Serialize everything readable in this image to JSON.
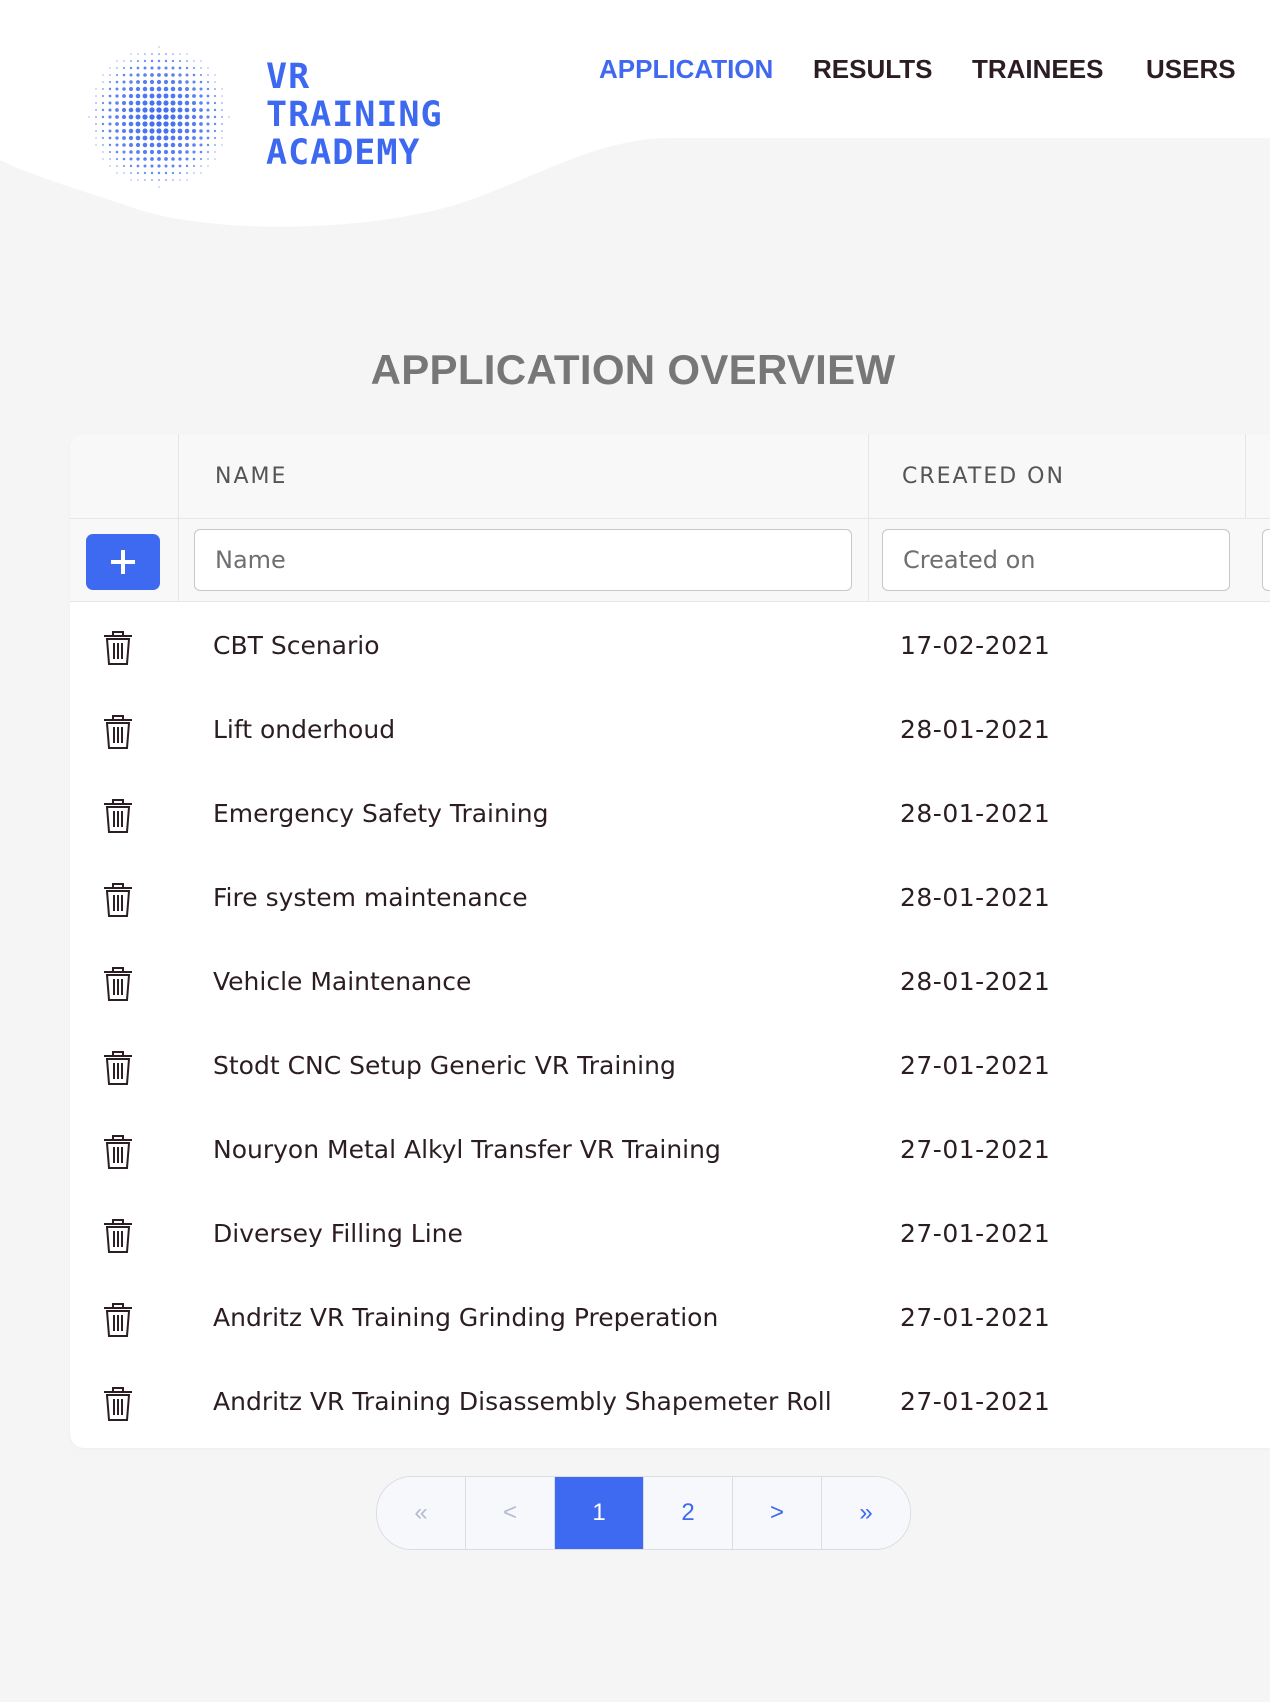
{
  "brand": {
    "line1": "VR",
    "line2": "TRAINING",
    "line3": "ACADEMY",
    "accent": "#3d6af0"
  },
  "nav": {
    "application": "APPLICATION",
    "results": "RESULTS",
    "trainees": "TRAINEES",
    "users": "USERS",
    "active": "APPLICATION"
  },
  "page": {
    "title": "APPLICATION OVERVIEW"
  },
  "table": {
    "columns": [
      "NAME",
      "CREATED ON"
    ],
    "filters": {
      "name_placeholder": "Name",
      "created_placeholder": "Created on"
    },
    "rows": [
      {
        "name": "CBT Scenario",
        "created": "17-02-2021"
      },
      {
        "name": "Lift onderhoud",
        "created": "28-01-2021"
      },
      {
        "name": "Emergency Safety Training",
        "created": "28-01-2021"
      },
      {
        "name": "Fire system maintenance",
        "created": "28-01-2021"
      },
      {
        "name": "Vehicle Maintenance",
        "created": "28-01-2021"
      },
      {
        "name": "Stodt CNC Setup Generic VR Training",
        "created": "27-01-2021"
      },
      {
        "name": "Nouryon Metal Alkyl Transfer VR Training",
        "created": "27-01-2021"
      },
      {
        "name": "Diversey Filling Line",
        "created": "27-01-2021"
      },
      {
        "name": "Andritz VR Training Grinding Preperation",
        "created": "27-01-2021"
      },
      {
        "name": "Andritz VR Training Disassembly Shapemeter Roll",
        "created": "27-01-2021"
      }
    ]
  },
  "pagination": {
    "first": "«",
    "prev": "<",
    "pages": [
      "1",
      "2"
    ],
    "current": "1",
    "next": ">",
    "last": "»"
  }
}
